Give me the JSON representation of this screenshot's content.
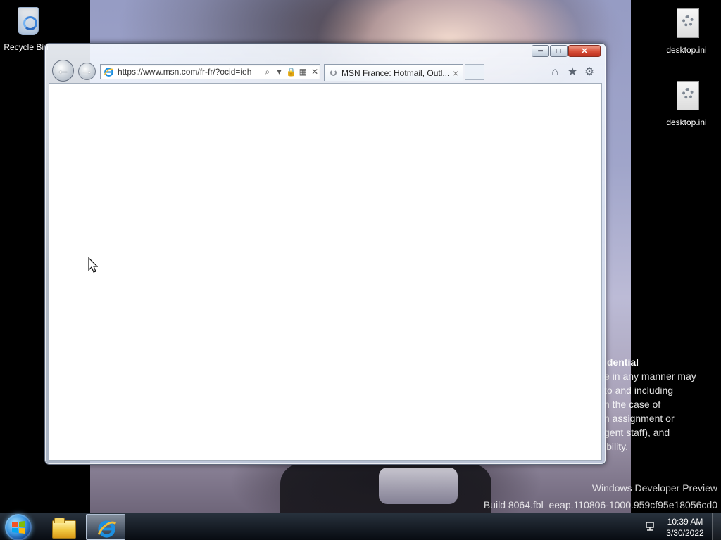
{
  "desktop": {
    "icons": [
      {
        "label": "Recycle Bin",
        "icon": "recycle-bin-icon"
      },
      {
        "label": "desktop.ini",
        "icon": "settings-file-icon"
      },
      {
        "label": "desktop.ini",
        "icon": "settings-file-icon"
      }
    ],
    "confidential": {
      "heading": "idential",
      "lines": [
        "e in any manner may",
        "to and including",
        "n the case of",
        "n assignment or",
        "gent staff), and",
        "ibility."
      ]
    },
    "watermark": {
      "line1": "Windows Developer Preview",
      "line2": "Build 8064.fbl_eeap.110806-1000.959cf95e18056cd0"
    }
  },
  "browser": {
    "navigation": {
      "back_icon": "back-arrow-icon",
      "forward_icon": "forward-arrow-icon"
    },
    "address_bar": {
      "url": "https://www.msn.com/fr-fr/?ocid=ieh",
      "search_icon": "search-icon",
      "dropdown_icon": "chevron-down-icon",
      "lock_icon": "lock-icon",
      "compat_icon": "compatibility-view-icon",
      "stop_icon": "stop-icon"
    },
    "tab": {
      "title": "MSN France: Hotmail, Outl...",
      "status_icon": "loading-spinner-icon",
      "close_icon": "close-icon"
    },
    "command_icons": {
      "home": "home-icon",
      "favorites": "favorites-icon",
      "tools": "gear-icon"
    },
    "window_controls": {
      "minimize": "minimize-icon",
      "maximize": "maximize-icon",
      "close": "close-icon"
    }
  },
  "taskbar": {
    "start_icon": "windows-start-icon",
    "pinned_apps": [
      {
        "name": "File Explorer",
        "icon": "folder-icon"
      },
      {
        "name": "Internet Explorer",
        "icon": "internet-explorer-icon"
      }
    ],
    "tray": {
      "network_icon": "network-icon",
      "time": "10:39 AM",
      "date": "3/30/2022"
    }
  },
  "colors": {
    "taskbar": "#101722",
    "browser_frame": "#d9e2ee",
    "close_button": "#d9513b",
    "ie_blue": "#1d8fe0"
  }
}
